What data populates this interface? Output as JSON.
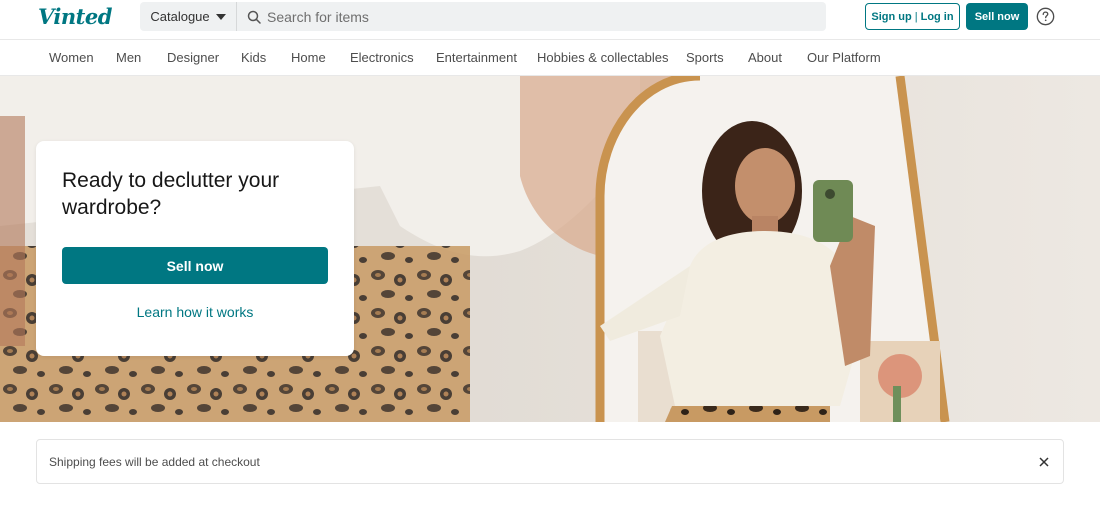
{
  "header": {
    "logo": "Vinted",
    "catalogue_label": "Catalogue",
    "search_placeholder": "Search for items",
    "signup_label": "Sign up",
    "login_label": "Log in",
    "sell_label": "Sell now",
    "help_icon": "question-circle-icon",
    "brand_color": "#007782"
  },
  "nav": {
    "items": [
      "Women",
      "Men",
      "Designer",
      "Kids",
      "Home",
      "Electronics",
      "Entertainment",
      "Hobbies & collectables",
      "Sports",
      "About",
      "Our Platform"
    ]
  },
  "hero": {
    "title": "Ready to declutter your wardrobe?",
    "sell_button": "Sell now",
    "learn_link": "Learn how it works"
  },
  "notice": {
    "text": "Shipping fees will be added at checkout",
    "close_icon": "close-icon"
  }
}
